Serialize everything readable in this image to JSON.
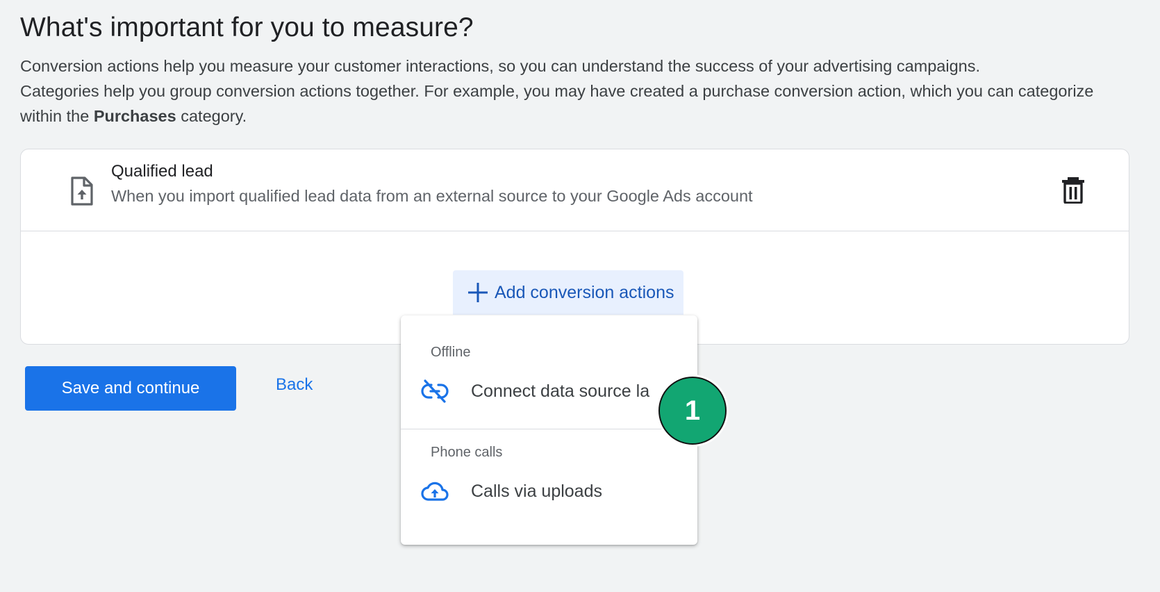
{
  "page": {
    "heading": "What's important for you to measure?",
    "description_line1": "Conversion actions help you measure your customer interactions, so you can understand the success of your advertising campaigns.",
    "description_line2_prefix": "Categories help you group conversion actions together. For example, you may have created a purchase conversion action, which you can categorize within the ",
    "description_bold": "Purchases",
    "description_suffix": " category."
  },
  "conversion_row": {
    "icon": "file-upload-icon",
    "title": "Qualified lead",
    "subtitle": "When you import qualified lead data from an external source to your Google Ads account",
    "delete_icon": "trash-icon"
  },
  "add_button": {
    "icon": "plus-icon",
    "label": "Add conversion actions"
  },
  "menu": {
    "sections": [
      {
        "label": "Offline",
        "items": [
          {
            "icon": "link-off-icon",
            "label": "Connect data source la"
          }
        ]
      },
      {
        "label": "Phone calls",
        "items": [
          {
            "icon": "cloud-upload-icon",
            "label": "Calls via uploads"
          }
        ]
      }
    ]
  },
  "actions": {
    "save_label": "Save and continue",
    "back_label": "Back"
  },
  "step_badge": {
    "number": "1"
  },
  "colors": {
    "background": "#f1f3f4",
    "primary": "#1a73e8",
    "add_button_bg": "#e8f0fe",
    "badge_green": "#12a672"
  }
}
